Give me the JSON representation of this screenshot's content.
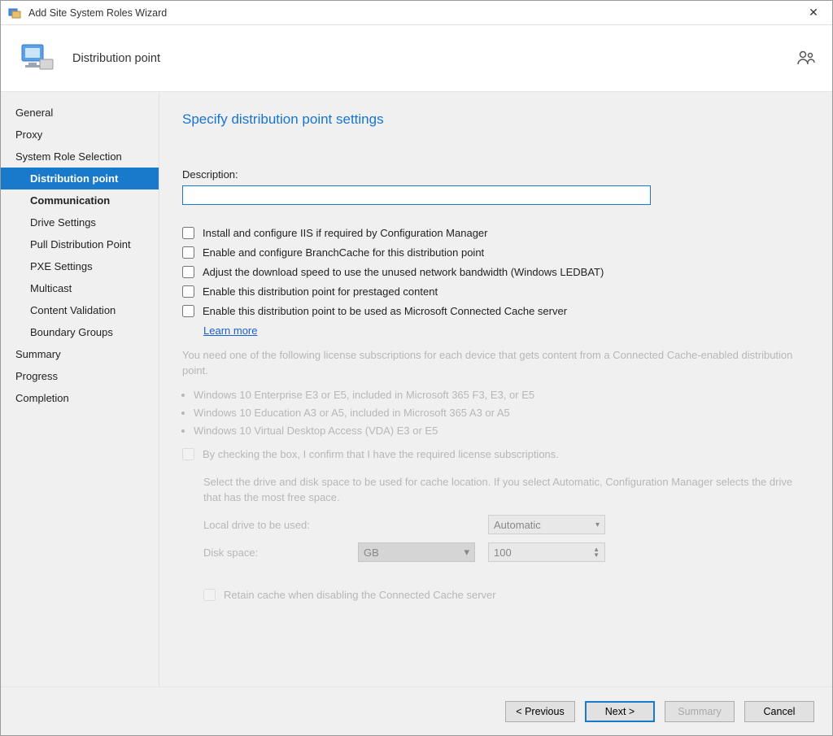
{
  "titlebar": {
    "title": "Add Site System Roles Wizard"
  },
  "banner": {
    "title": "Distribution point"
  },
  "sidebar": {
    "items": [
      {
        "label": "General",
        "level": 0
      },
      {
        "label": "Proxy",
        "level": 0
      },
      {
        "label": "System Role Selection",
        "level": 0
      },
      {
        "label": "Distribution point",
        "level": 1,
        "selected": true,
        "bold": true
      },
      {
        "label": "Communication",
        "level": 1,
        "bold": true
      },
      {
        "label": "Drive Settings",
        "level": 1
      },
      {
        "label": "Pull Distribution Point",
        "level": 1
      },
      {
        "label": "PXE Settings",
        "level": 1
      },
      {
        "label": "Multicast",
        "level": 1
      },
      {
        "label": "Content Validation",
        "level": 1
      },
      {
        "label": "Boundary Groups",
        "level": 1
      },
      {
        "label": "Summary",
        "level": 0
      },
      {
        "label": "Progress",
        "level": 0
      },
      {
        "label": "Completion",
        "level": 0
      }
    ]
  },
  "content": {
    "heading": "Specify distribution point settings",
    "description_label": "Description:",
    "description_value": "",
    "cb_iis": "Install and configure IIS if required by Configuration Manager",
    "cb_branchcache": "Enable and configure BranchCache for this distribution point",
    "cb_ledbat": "Adjust the download speed to use the unused network bandwidth (Windows LEDBAT)",
    "cb_prestaged": "Enable this distribution point for prestaged content",
    "cb_connected_cache": "Enable this distribution point to be used as Microsoft Connected Cache server",
    "learn_more": "Learn more",
    "license_note": "You need one of the following license subscriptions for each device that gets content from a Connected Cache-enabled distribution point.",
    "license_bullets": [
      "Windows 10 Enterprise E3 or E5, included in Microsoft 365 F3, E3, or E5",
      "Windows 10 Education A3 or A5, included in Microsoft 365 A3 or A5",
      "Windows 10 Virtual Desktop Access (VDA) E3 or E5"
    ],
    "cb_confirm": "By checking the box, I confirm that I have the required license subscriptions.",
    "drive_note": "Select the drive and disk space to be used for cache location. If you select Automatic, Configuration Manager selects the drive that has the most free space.",
    "local_drive_label": "Local drive to be used:",
    "local_drive_value": "Automatic",
    "disk_space_label": "Disk space:",
    "disk_space_unit": "GB",
    "disk_space_value": "100",
    "cb_retain": "Retain cache when disabling the Connected Cache server"
  },
  "footer": {
    "previous": "< Previous",
    "next": "Next >",
    "summary": "Summary",
    "cancel": "Cancel"
  }
}
